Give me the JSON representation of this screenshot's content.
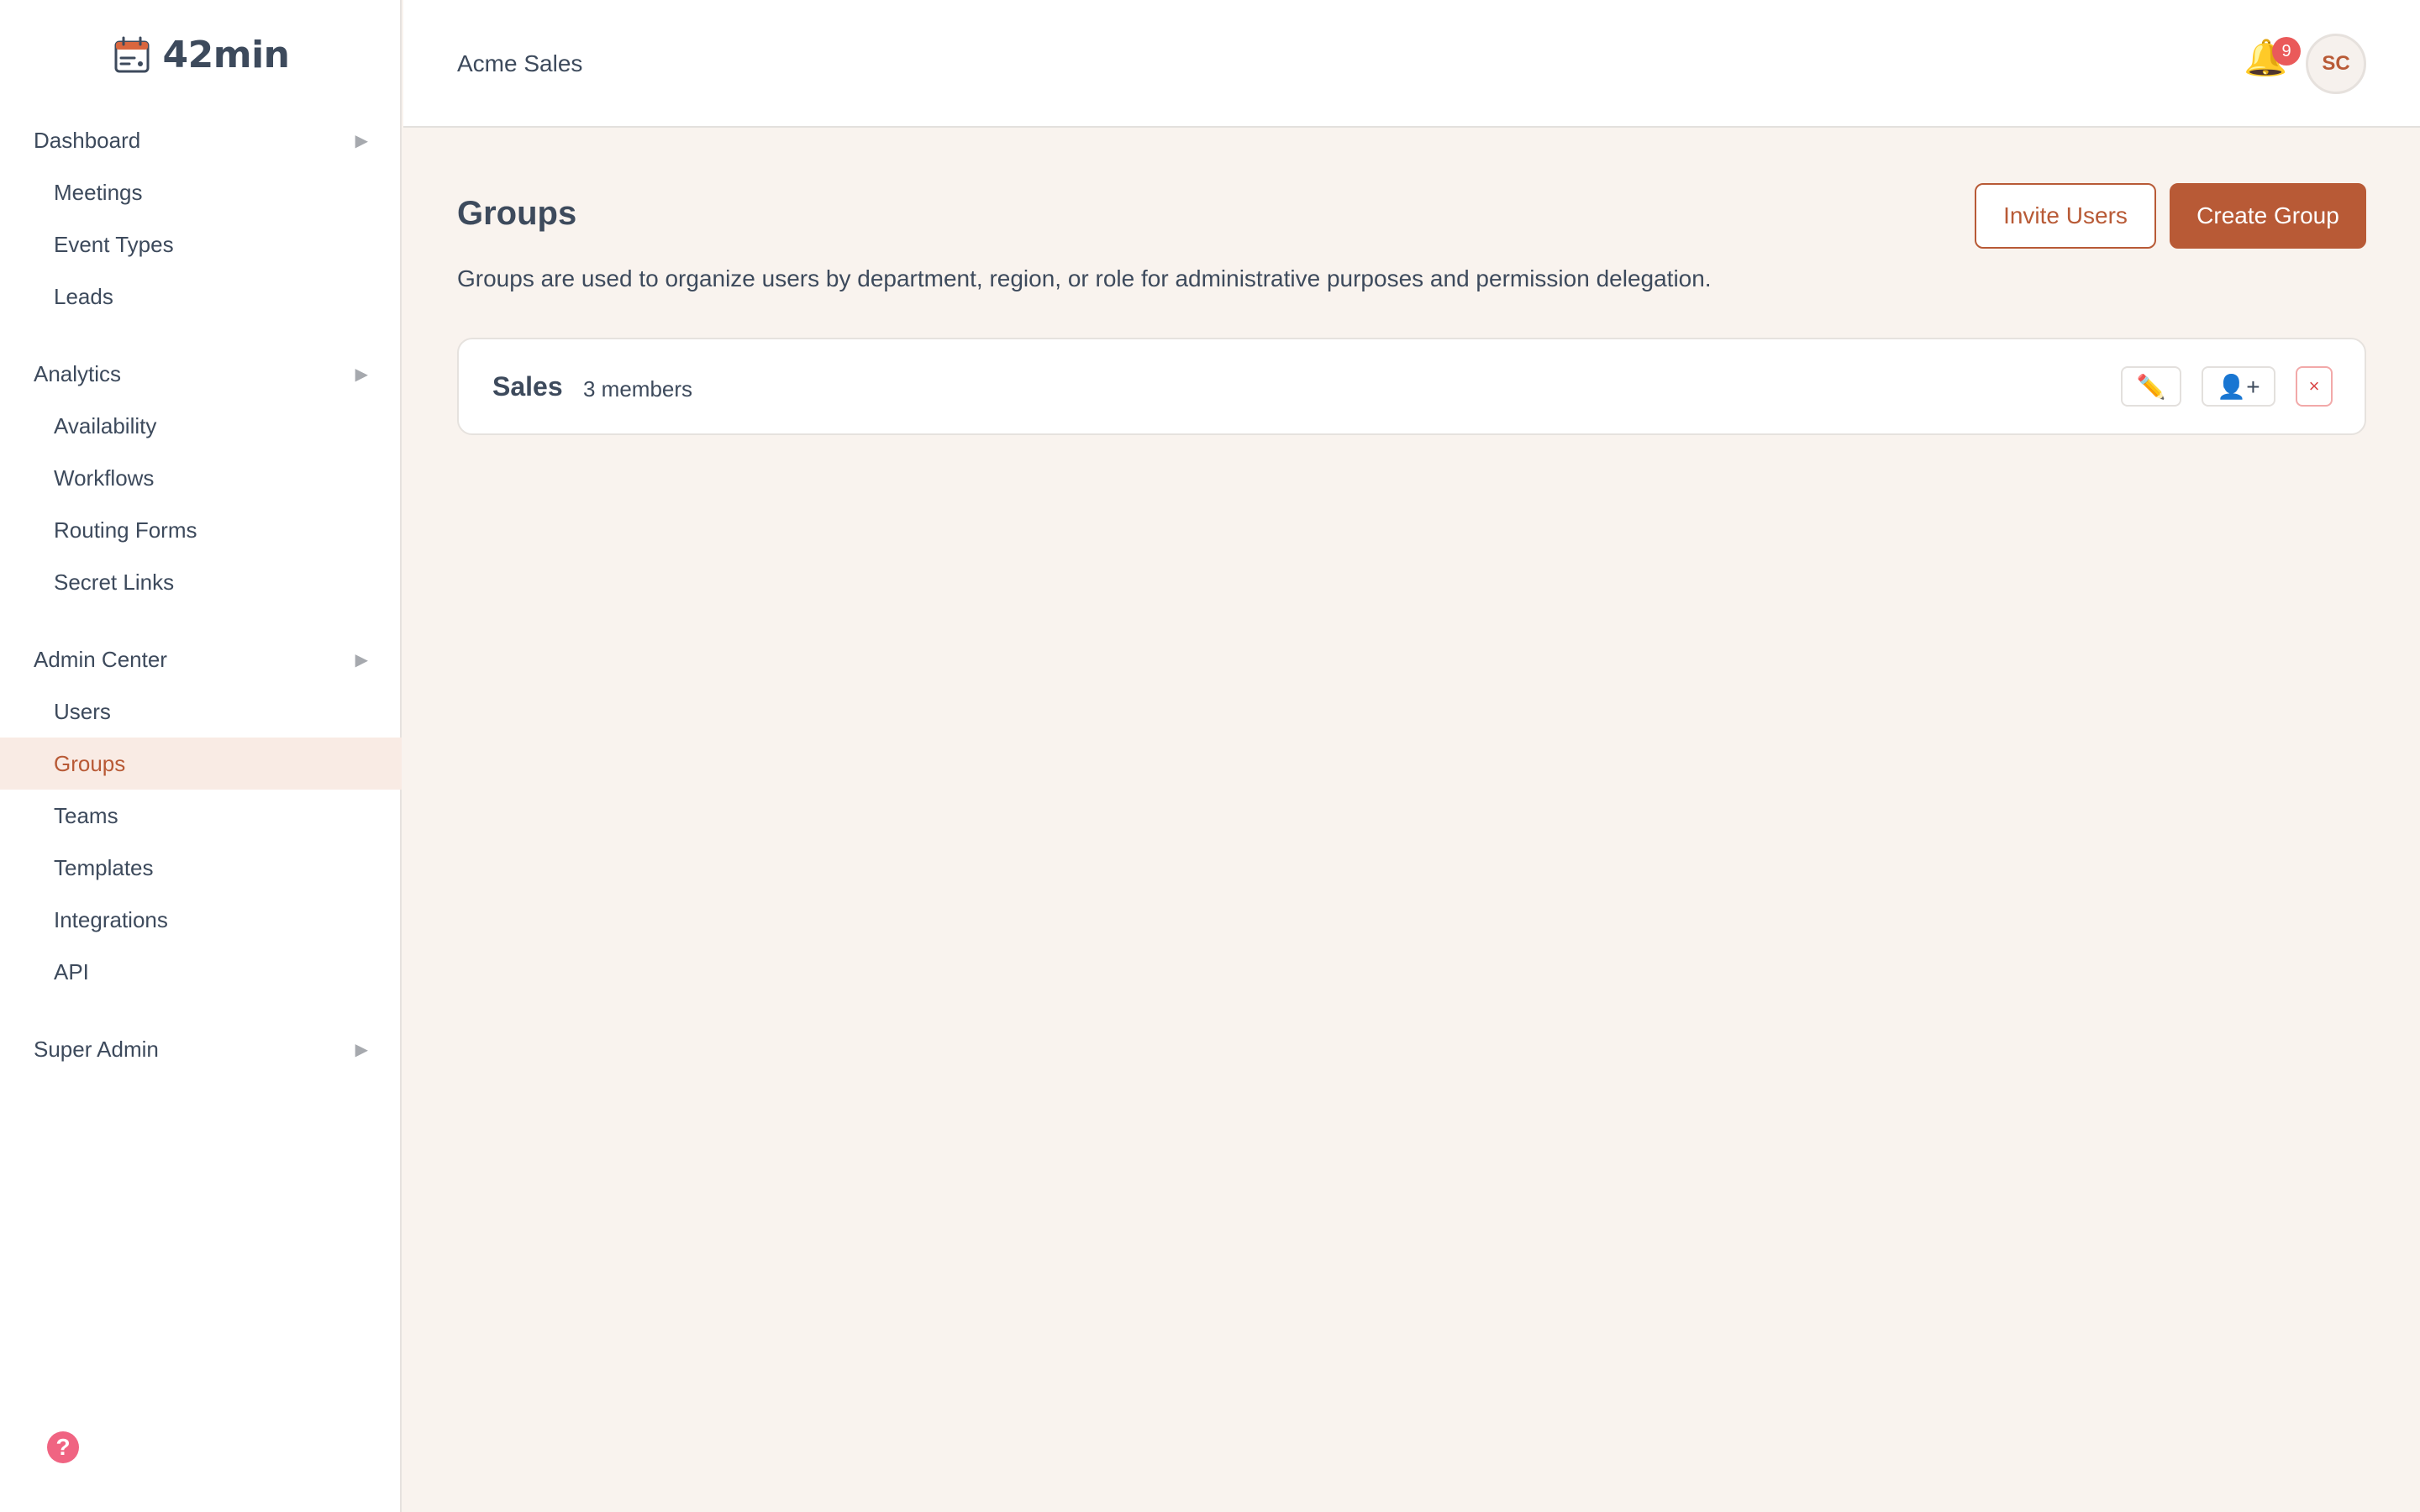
{
  "app": {
    "logo_text": "42min",
    "logo_icon": "calendar-icon"
  },
  "sidebar": {
    "sections": [
      {
        "label": "Dashboard",
        "items": [
          "Meetings",
          "Event Types",
          "Leads"
        ]
      },
      {
        "label": "Analytics",
        "items": [
          "Availability",
          "Workflows",
          "Routing Forms",
          "Secret Links"
        ]
      },
      {
        "label": "Admin Center",
        "items": [
          "Users",
          "Groups",
          "Teams",
          "Templates",
          "Integrations",
          "API"
        ]
      },
      {
        "label": "Super Admin",
        "items": []
      }
    ],
    "active_item": "Groups",
    "help_glyph": "?"
  },
  "header": {
    "org_name": "Acme Sales",
    "notification_count": "9",
    "avatar_initials": "SC"
  },
  "page": {
    "title": "Groups",
    "description": "Groups are used to organize users by department, region, or role for administrative purposes and permission delegation.",
    "invite_button": "Invite Users",
    "create_button": "Create Group"
  },
  "groups": [
    {
      "name": "Sales",
      "member_count": "3 members",
      "edit_glyph": "✏️",
      "add_member_glyph": "👤+",
      "delete_glyph": "×"
    }
  ],
  "colors": {
    "accent": "#b85a36",
    "active_bg": "#f9ebe4",
    "page_bg": "#f9f3ee",
    "badge": "#ea5a5a",
    "help": "#f06482"
  }
}
